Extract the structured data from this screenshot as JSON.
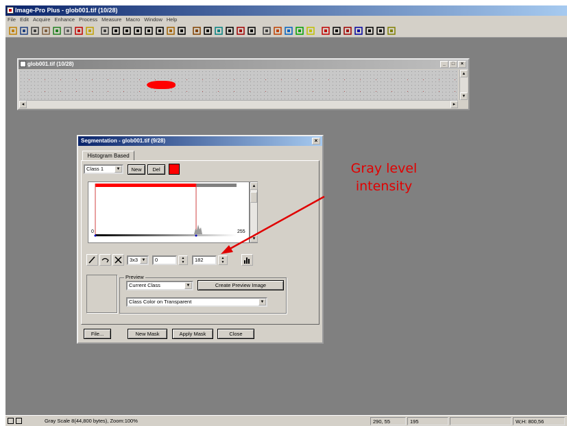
{
  "app": {
    "title": "Image-Pro Plus - glob001.tif (10/28)",
    "menu": [
      "File",
      "Edit",
      "Acquire",
      "Enhance",
      "Process",
      "Measure",
      "Macro",
      "Window",
      "Help"
    ]
  },
  "toolbar_icons": [
    "open-icon",
    "save-icon",
    "grid-icon",
    "acquire-icon",
    "shapes-icon",
    "print-icon",
    "book-icon",
    "mail-icon",
    "undo-icon",
    "new-aoi-icon",
    "rect-icon",
    "ellipse-icon",
    "freehand-icon",
    "polygon-icon",
    "pen-icon",
    "zoom-icon",
    "hand-icon",
    "histogram-icon",
    "line-profile-icon",
    "bitmap-icon",
    "tool-icon",
    "segment-icon",
    "grid2-icon",
    "count-icon",
    "bar-icon",
    "list-icon",
    "link-icon",
    "color-icon",
    "align-icon",
    "chart-icon",
    "plot-icon",
    "image-icon",
    "macro-icon",
    "extra-icon"
  ],
  "image_window": {
    "title": "glob001.tif (10/28)",
    "min": "_",
    "max": "□",
    "close": "×"
  },
  "segmentation": {
    "title": "Segmentation - glob001.tif (9/28)",
    "close": "×",
    "tab_label": "Histogram Based",
    "class_select": "Class 1",
    "new_button": "New",
    "del_button": "Del",
    "class_color": "#ff0000",
    "histogram": {
      "min_label": "0",
      "max_label": "255",
      "range_low": 0,
      "range_high": 182,
      "range_max": 255
    },
    "kernel_select": "3x3",
    "low_value": "0",
    "high_value": "182",
    "preview": {
      "legend": "Preview",
      "mode_select": "Current Class",
      "create_button": "Create Preview Image",
      "overlay_select": "Class Color on Transparent"
    },
    "buttons": {
      "file": "File...",
      "new_mask": "New Mask",
      "apply_mask": "Apply Mask",
      "close": "Close"
    }
  },
  "annotation": {
    "label": "Gray level\nintensity",
    "color": "#e00000"
  },
  "statusbar": {
    "info": "Gray Scale 8(44,800 bytes), Zoom:100%",
    "coords": "290, 55",
    "value": "195",
    "size": "W,H: 800,56"
  }
}
